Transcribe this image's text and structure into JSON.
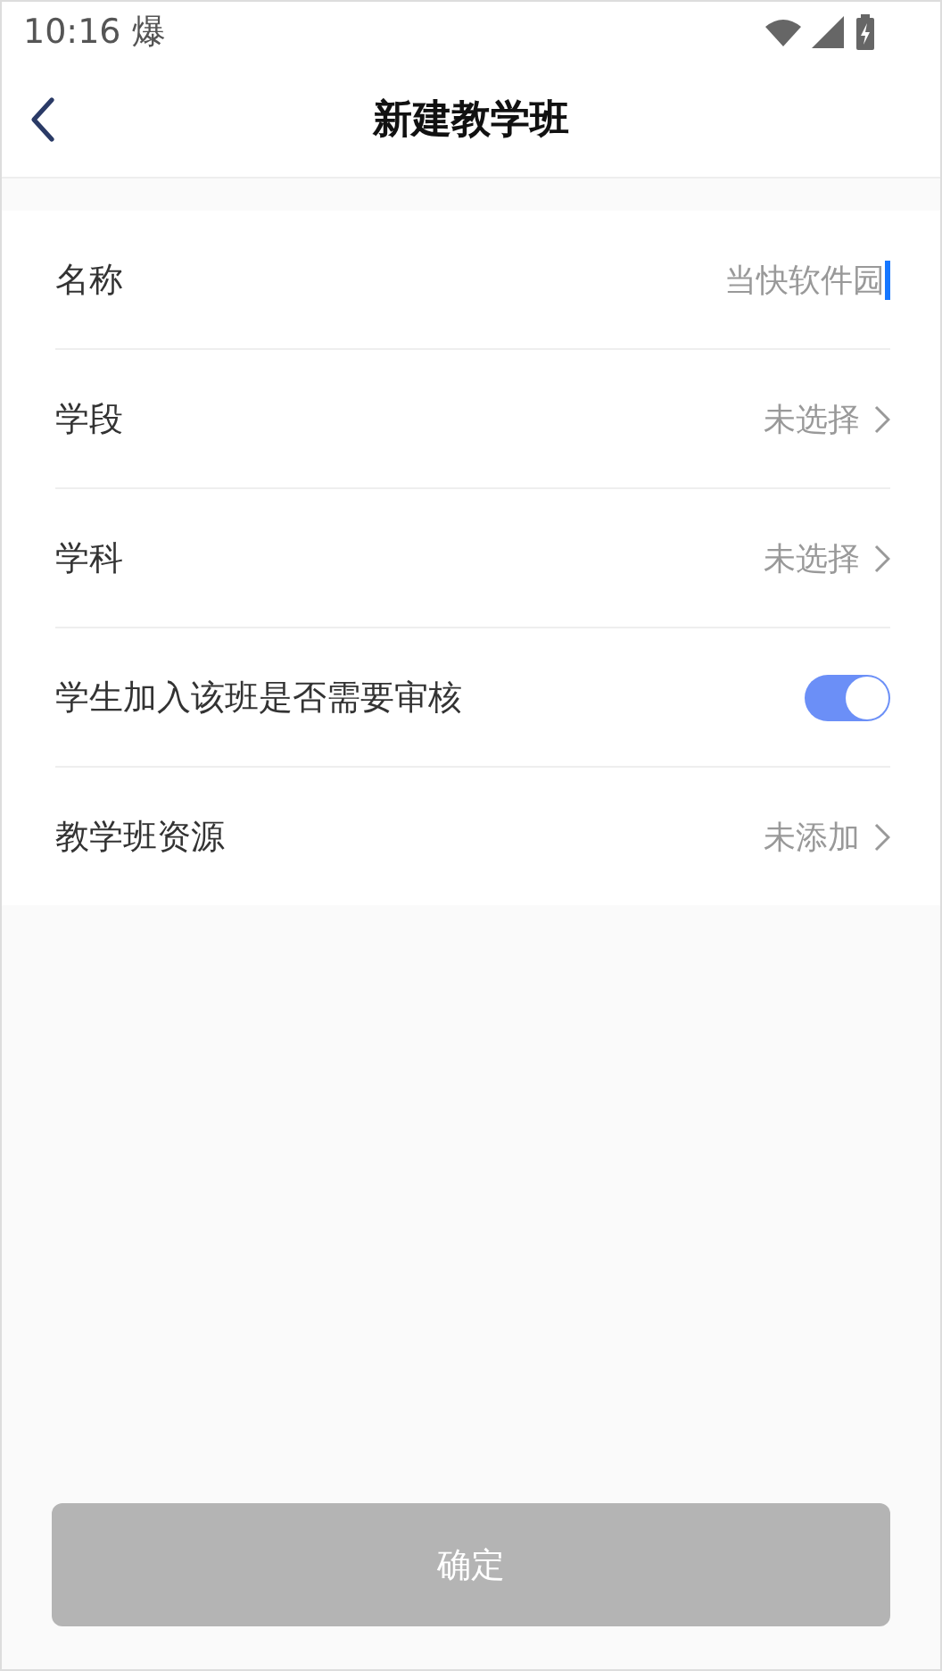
{
  "status_bar": {
    "time": "10:16",
    "notification": "爆"
  },
  "header": {
    "title": "新建教学班"
  },
  "rows": [
    {
      "kind": "input",
      "label": "名称",
      "value": "当快软件园"
    },
    {
      "kind": "select",
      "label": "学段",
      "value": "未选择"
    },
    {
      "kind": "select",
      "label": "学科",
      "value": "未选择"
    },
    {
      "kind": "toggle",
      "label": "学生加入该班是否需要审核",
      "on": true
    },
    {
      "kind": "select",
      "label": "教学班资源",
      "value": "未添加"
    }
  ],
  "confirm_button": {
    "label": "确定",
    "disabled": true
  }
}
